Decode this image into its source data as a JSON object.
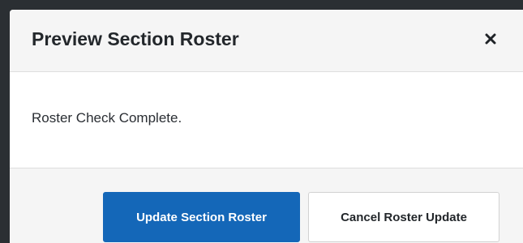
{
  "dialog": {
    "title": "Preview Section Roster",
    "close_icon": "close-icon",
    "message": "Roster Check Complete.",
    "buttons": {
      "update_label": "Update Section Roster",
      "cancel_label": "Cancel Roster Update"
    }
  },
  "colors": {
    "primary": "#1467b8",
    "header_bg": "#f5f5f5",
    "text": "#23272b"
  }
}
